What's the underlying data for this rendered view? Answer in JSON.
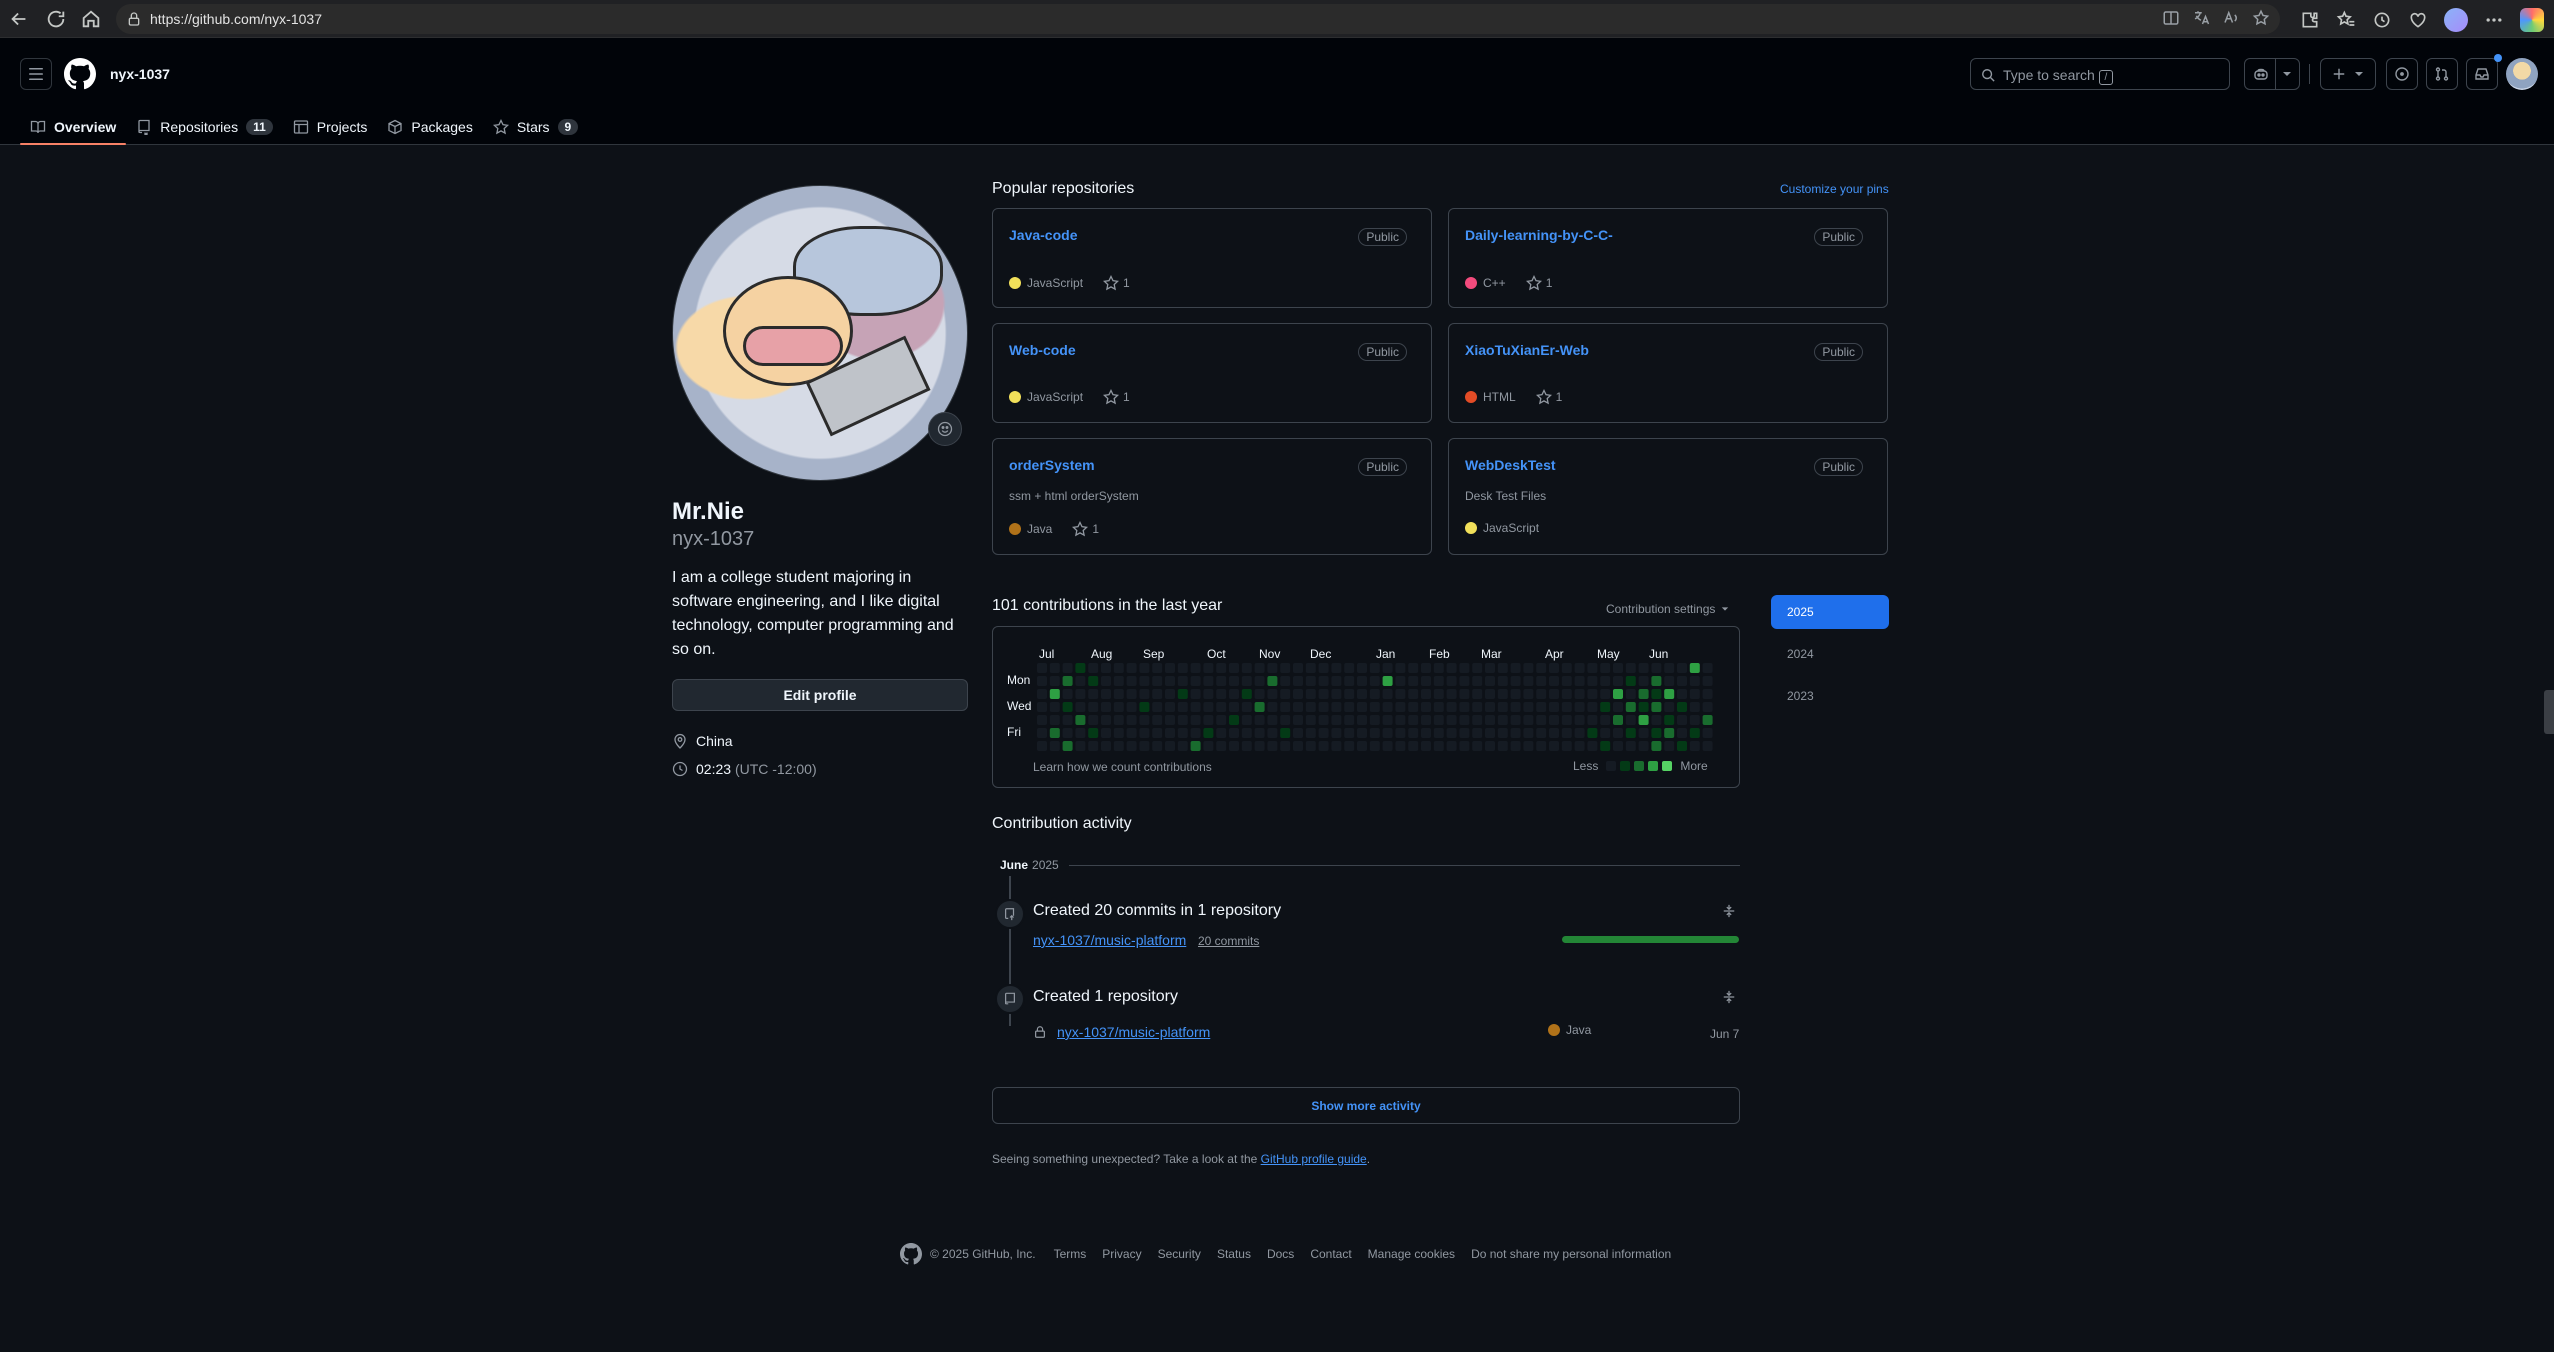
{
  "browser": {
    "url": "https://github.com/nyx-1037"
  },
  "header": {
    "username": "nyx-1037",
    "search_placeholder": "Type to search",
    "search_shortcut": "/"
  },
  "tabs": [
    {
      "label": "Overview",
      "icon": "book-icon",
      "active": true
    },
    {
      "label": "Repositories",
      "count": "11",
      "icon": "repo-icon"
    },
    {
      "label": "Projects",
      "icon": "table-icon"
    },
    {
      "label": "Packages",
      "icon": "package-icon"
    },
    {
      "label": "Stars",
      "count": "9",
      "icon": "star-icon"
    }
  ],
  "profile": {
    "name": "Mr.Nie",
    "login": "nyx-1037",
    "bio": "I am a college student majoring in software engineering, and I like digital technology, computer programming and so on.",
    "edit_label": "Edit profile",
    "location": "China",
    "time": "02:23",
    "timezone": "(UTC -12:00)"
  },
  "popular": {
    "title": "Popular repositories",
    "customize_label": "Customize your pins",
    "repos": [
      {
        "name": "Java-code",
        "visibility": "Public",
        "description": "",
        "language": "JavaScript",
        "lang_color": "#f1e05a",
        "stars": "1"
      },
      {
        "name": "Daily-learning-by-C-C-",
        "visibility": "Public",
        "description": "",
        "language": "C++",
        "lang_color": "#f34b7d",
        "stars": "1"
      },
      {
        "name": "Web-code",
        "visibility": "Public",
        "description": "",
        "language": "JavaScript",
        "lang_color": "#f1e05a",
        "stars": "1"
      },
      {
        "name": "XiaoTuXianEr-Web",
        "visibility": "Public",
        "description": "",
        "language": "HTML",
        "lang_color": "#e34c26",
        "stars": "1"
      },
      {
        "name": "orderSystem",
        "visibility": "Public",
        "description": "ssm + html orderSystem",
        "language": "Java",
        "lang_color": "#b07219",
        "stars": "1"
      },
      {
        "name": "WebDeskTest",
        "visibility": "Public",
        "description": "Desk Test Files",
        "language": "JavaScript",
        "lang_color": "#f1e05a",
        "stars": ""
      }
    ]
  },
  "contributions": {
    "title": "101 contributions in the last year",
    "settings_label": "Contribution settings",
    "months": [
      "Jul",
      "Aug",
      "Sep",
      "Oct",
      "Nov",
      "Dec",
      "Jan",
      "Feb",
      "Mar",
      "Apr",
      "May",
      "Jun"
    ],
    "day_labels": [
      "Mon",
      "Wed",
      "Fri"
    ],
    "learn_label": "Learn how we count contributions",
    "legend_less": "Less",
    "legend_more": "More",
    "level_colors": [
      "#151b23",
      "#033a16",
      "#196c2e",
      "#2ea043",
      "#56d364"
    ],
    "years": [
      "2025",
      "2024",
      "2023"
    ],
    "selected_year": "2025"
  },
  "activity": {
    "title": "Contribution activity",
    "month": "June",
    "year": "2025",
    "events": [
      {
        "title": "Created 20 commits in 1 repository",
        "repo": "nyx-1037/music-platform",
        "commits": "20 commits"
      },
      {
        "title": "Created 1 repository",
        "repo": "nyx-1037/music-platform",
        "language": "Java",
        "lang_color": "#b07219",
        "date": "Jun 7"
      }
    ],
    "more_label": "Show more activity",
    "guide_text": "Seeing something unexpected? Take a look at the",
    "guide_link": "GitHub profile guide",
    "guide_end": "."
  },
  "footer": {
    "copyright": "© 2025 GitHub, Inc.",
    "links": [
      "Terms",
      "Privacy",
      "Security",
      "Status",
      "Docs",
      "Contact",
      "Manage cookies",
      "Do not share my personal information"
    ]
  }
}
